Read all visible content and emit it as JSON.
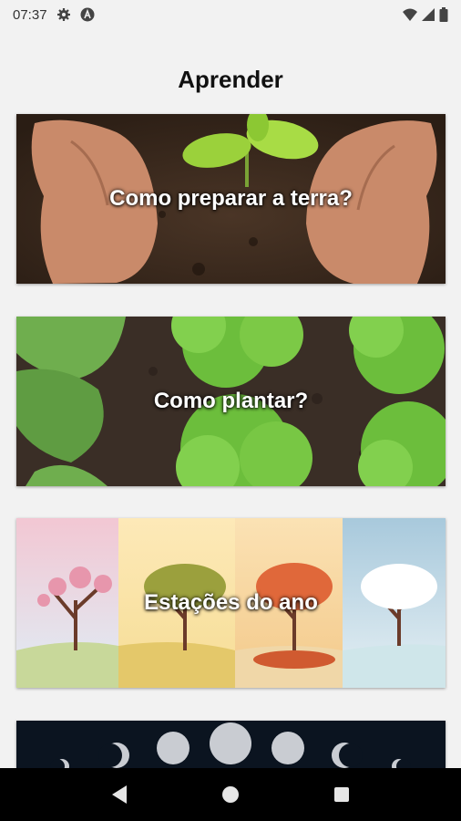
{
  "status_bar": {
    "time": "07:37",
    "icons": [
      "settings-icon",
      "a-badge-icon",
      "wifi-icon",
      "signal-icon",
      "battery-icon"
    ]
  },
  "page": {
    "title": "Aprender"
  },
  "cards": [
    {
      "label": "Como preparar a terra?",
      "image": "hands-soil-seedling-photo"
    },
    {
      "label": "Como plantar?",
      "image": "lettuce-garden-photo"
    },
    {
      "label": "Estações do ano",
      "image": "four-seasons-trees-photo"
    },
    {
      "label": "",
      "image": "moon-phases-photo"
    }
  ],
  "nav_bar": {
    "icons": [
      "back-icon",
      "home-icon",
      "recents-icon"
    ]
  },
  "colors": {
    "background": "#f2f2f2",
    "nav_bar": "#000000",
    "title_text": "#111111",
    "card_text": "#ffffff"
  }
}
